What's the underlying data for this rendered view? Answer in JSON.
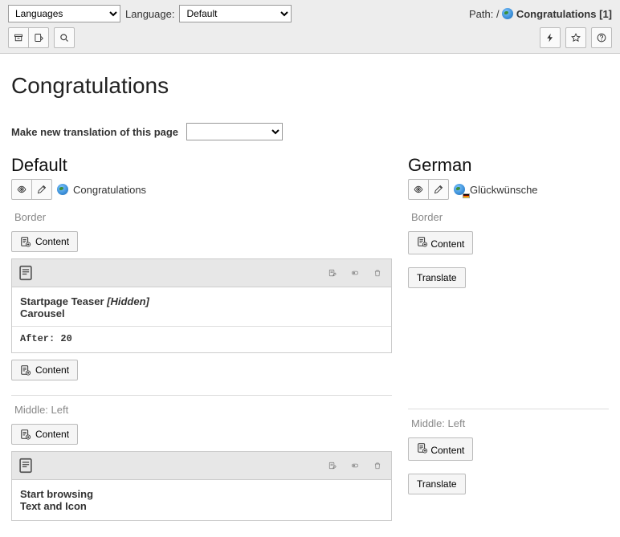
{
  "topbar": {
    "language_selector_value": "Languages",
    "language_label": "Language:",
    "language_default_value": "Default",
    "path_label": "Path:",
    "path_root": "/",
    "path_title": "Congratulations",
    "path_id": "[1]"
  },
  "page": {
    "heading": "Congratulations",
    "new_translation_label": "Make new translation of this page"
  },
  "columns": {
    "default": {
      "heading": "Default",
      "page_title": "Congratulations",
      "zones": {
        "border": {
          "label": "Border",
          "content_btn": "Content",
          "content_btn2": "Content",
          "element": {
            "title": "Startpage Teaser",
            "hidden": "[Hidden]",
            "ctype": "Carousel",
            "after": "After: 20"
          }
        },
        "middle_left": {
          "label": "Middle: Left",
          "content_btn": "Content",
          "element": {
            "title": "Start browsing",
            "ctype": "Text and Icon"
          }
        }
      }
    },
    "german": {
      "heading": "German",
      "page_title": "Glückwünsche",
      "zones": {
        "border": {
          "label": "Border",
          "content_btn": "Content",
          "translate_btn": "Translate"
        },
        "middle_left": {
          "label": "Middle: Left",
          "content_btn": "Content",
          "translate_btn": "Translate"
        }
      }
    }
  }
}
